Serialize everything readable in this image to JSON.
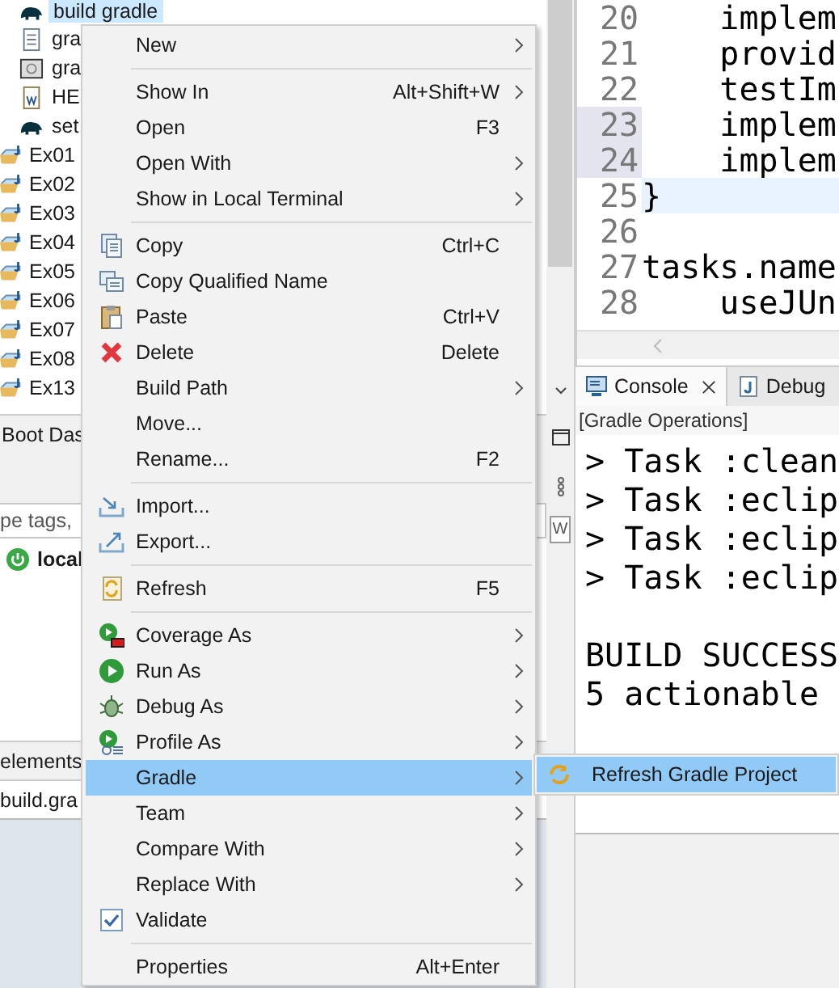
{
  "explorer": {
    "items": [
      {
        "label": "build gradle",
        "kind": "gradle",
        "selected": true
      },
      {
        "label": "gra",
        "kind": "text",
        "selected": false
      },
      {
        "label": "gra",
        "kind": "config",
        "selected": false
      },
      {
        "label": "HE",
        "kind": "word",
        "selected": false
      },
      {
        "label": "set",
        "kind": "gradle",
        "selected": false
      },
      {
        "label": "Ex01",
        "kind": "project",
        "selected": false
      },
      {
        "label": "Ex02",
        "kind": "project",
        "selected": false
      },
      {
        "label": "Ex03",
        "kind": "project",
        "selected": false
      },
      {
        "label": "Ex04",
        "kind": "project",
        "selected": false
      },
      {
        "label": "Ex05",
        "kind": "project",
        "selected": false
      },
      {
        "label": "Ex06",
        "kind": "project",
        "selected": false
      },
      {
        "label": "Ex07",
        "kind": "project",
        "selected": false
      },
      {
        "label": "Ex08",
        "kind": "project",
        "selected": false
      },
      {
        "label": "Ex13",
        "kind": "project",
        "selected": false
      }
    ]
  },
  "boot_dashboard": {
    "title": "Boot Das",
    "filter_placeholder": "pe tags,",
    "items": [
      {
        "label": "local"
      }
    ]
  },
  "outline_title": "elements",
  "editor_tab": "build.gra",
  "side_strip": {
    "text": "W"
  },
  "editor": {
    "lines": [
      {
        "number": "20",
        "code": "    implem",
        "marked": false,
        "current": false
      },
      {
        "number": "21",
        "code": "    provid",
        "marked": false,
        "current": false
      },
      {
        "number": "22",
        "code": "    testIm",
        "marked": false,
        "current": false
      },
      {
        "number": "23",
        "code": "    implem",
        "marked": true,
        "current": false
      },
      {
        "number": "24",
        "code": "    implem",
        "marked": true,
        "current": false
      },
      {
        "number": "25",
        "code": "}",
        "marked": false,
        "current": true
      },
      {
        "number": "26",
        "marked": false,
        "current": false
      },
      {
        "number": "27",
        "code": "tasks.name",
        "marked": false,
        "current": false
      },
      {
        "number": "28",
        "code": "    useJUn",
        "marked": false,
        "current": false
      }
    ]
  },
  "console": {
    "tabs": [
      {
        "label": "Console",
        "selected": true,
        "closable": true
      },
      {
        "label": "Debug",
        "selected": false,
        "closable": false
      }
    ],
    "header": "[Gradle Operations]",
    "lines": [
      {
        "kind": "text",
        "text": "> Task :clean"
      },
      {
        "kind": "text",
        "text": "> Task :eclip"
      },
      {
        "kind": "text",
        "text": "> Task :eclip"
      },
      {
        "kind": "text",
        "text": "> Task :eclip"
      },
      {
        "kind": "blank"
      },
      {
        "kind": "text",
        "text": "BUILD SUCCESS"
      },
      {
        "kind": "text",
        "text": "5 actionable"
      }
    ]
  },
  "context_menu": {
    "items": [
      {
        "kind": "item",
        "label": "New",
        "submenu": true,
        "selected": false
      },
      {
        "kind": "separator"
      },
      {
        "kind": "item",
        "label": "Show In",
        "shortcut": "Alt+Shift+W",
        "submenu": true,
        "selected": false
      },
      {
        "kind": "item",
        "label": "Open",
        "shortcut": "F3",
        "submenu": false,
        "selected": false
      },
      {
        "kind": "item",
        "label": "Open With",
        "submenu": true,
        "selected": false
      },
      {
        "kind": "item",
        "label": "Show in Local Terminal",
        "submenu": true,
        "selected": false
      },
      {
        "kind": "separator"
      },
      {
        "kind": "item",
        "label": "Copy",
        "shortcut": "Ctrl+C",
        "submenu": false,
        "selected": false
      },
      {
        "kind": "item",
        "label": "Copy Qualified Name",
        "submenu": false,
        "selected": false
      },
      {
        "kind": "item",
        "label": "Paste",
        "shortcut": "Ctrl+V",
        "submenu": false,
        "selected": false
      },
      {
        "kind": "item",
        "label": "Delete",
        "shortcut": "Delete",
        "submenu": false,
        "selected": false
      },
      {
        "kind": "item",
        "label": "Build Path",
        "submenu": true,
        "selected": false
      },
      {
        "kind": "item",
        "label": "Move...",
        "submenu": false,
        "selected": false
      },
      {
        "kind": "item",
        "label": "Rename...",
        "shortcut": "F2",
        "submenu": false,
        "selected": false
      },
      {
        "kind": "separator"
      },
      {
        "kind": "item",
        "label": "Import...",
        "submenu": false,
        "selected": false
      },
      {
        "kind": "item",
        "label": "Export...",
        "submenu": false,
        "selected": false
      },
      {
        "kind": "separator"
      },
      {
        "kind": "item",
        "label": "Refresh",
        "shortcut": "F5",
        "submenu": false,
        "selected": false
      },
      {
        "kind": "separator"
      },
      {
        "kind": "item",
        "label": "Coverage As",
        "submenu": true,
        "selected": false
      },
      {
        "kind": "item",
        "label": "Run As",
        "submenu": true,
        "selected": false
      },
      {
        "kind": "item",
        "label": "Debug As",
        "submenu": true,
        "selected": false
      },
      {
        "kind": "item",
        "label": "Profile As",
        "submenu": true,
        "selected": false
      },
      {
        "kind": "item",
        "label": "Gradle",
        "submenu": true,
        "selected": true
      },
      {
        "kind": "item",
        "label": "Team",
        "submenu": true,
        "selected": false
      },
      {
        "kind": "item",
        "label": "Compare With",
        "submenu": true,
        "selected": false
      },
      {
        "kind": "item",
        "label": "Replace With",
        "submenu": true,
        "selected": false
      },
      {
        "kind": "item",
        "label": "Validate",
        "submenu": false,
        "selected": false
      },
      {
        "kind": "separator"
      },
      {
        "kind": "item",
        "label": "Properties",
        "shortcut": "Alt+Enter",
        "submenu": false,
        "selected": false
      }
    ]
  },
  "submenu": {
    "items": [
      {
        "label": "Refresh Gradle Project",
        "selected": true
      }
    ]
  }
}
